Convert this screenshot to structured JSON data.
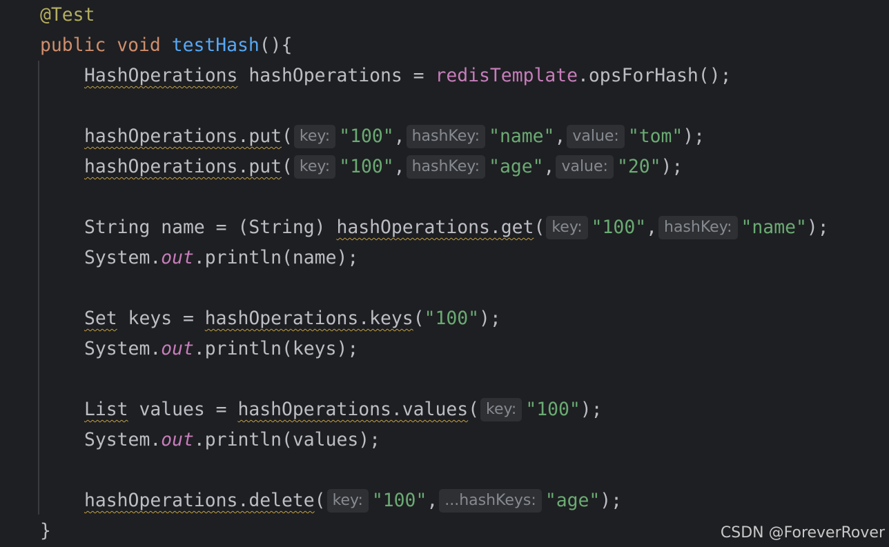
{
  "code": {
    "annotation": "@Test",
    "method_kw_public": "public",
    "method_kw_void": "void",
    "method_name": "testHash",
    "method_open": "(){",
    "line1": {
      "type": "HashOperations",
      "sp1": " ",
      "var": "hashOperations",
      "eq": " = ",
      "field": "redisTemplate",
      "call": ".opsForHash();"
    },
    "line2": {
      "call": "hashOperations.put",
      "paren": "(",
      "hint1": "key:",
      "arg1": "\"100\"",
      "sep1": ",",
      "hint2": "hashKey:",
      "arg2": "\"name\"",
      "sep2": ",",
      "hint3": "value:",
      "arg3": "\"tom\"",
      "end": ");"
    },
    "line3": {
      "call": "hashOperations.put",
      "paren": "(",
      "hint1": "key:",
      "arg1": "\"100\"",
      "sep1": ",",
      "hint2": "hashKey:",
      "arg2": "\"age\"",
      "sep2": ",",
      "hint3": "value:",
      "arg3": "\"20\"",
      "end": ");"
    },
    "line4": {
      "pre": "String name = (String) ",
      "call": "hashOperations.get",
      "paren": "(",
      "hint1": "key:",
      "arg1": "\"100\"",
      "sep1": ",",
      "hint2": "hashKey:",
      "arg2": "\"name\"",
      "end": ");"
    },
    "line5": {
      "pre": "System.",
      "out": "out",
      "post": ".println(name);"
    },
    "line6": {
      "type": "Set",
      "mid": " keys = ",
      "call": "hashOperations.keys",
      "paren": "(",
      "arg1": "\"100\"",
      "end": ");"
    },
    "line7": {
      "pre": "System.",
      "out": "out",
      "post": ".println(keys);"
    },
    "line8": {
      "type": "List",
      "mid": " values = ",
      "call": "hashOperations.values",
      "paren": "(",
      "hint1": "key:",
      "arg1": "\"100\"",
      "end": ");"
    },
    "line9": {
      "pre": "System.",
      "out": "out",
      "post": ".println(values);"
    },
    "line10": {
      "call": "hashOperations.delete",
      "paren": "(",
      "hint1": "key:",
      "arg1": "\"100\"",
      "sep1": ",",
      "hint2": "...hashKeys:",
      "arg2": "\"age\"",
      "end": ");"
    },
    "close": "}"
  },
  "watermark": "CSDN @ForeverRover",
  "colors": {
    "background": "#1e1f22",
    "keyword": "#cf8e6d",
    "annotation": "#b3ae60",
    "method": "#56a8f5",
    "field": "#c77dbb",
    "string": "#6aab73",
    "text": "#bcbec4",
    "hint_bg": "#2f3033",
    "warning_underline": "#c3a246"
  }
}
